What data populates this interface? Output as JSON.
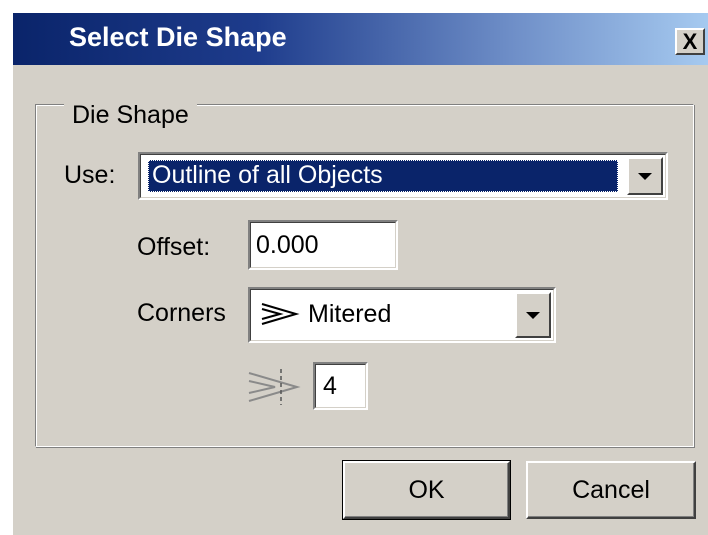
{
  "dialog": {
    "title": "Select Die Shape",
    "close_glyph": "X"
  },
  "group": {
    "legend": "Die Shape"
  },
  "use": {
    "label": "Use:",
    "selected": "Outline of all Objects"
  },
  "offset": {
    "label": "Offset:",
    "value": "0.000"
  },
  "corners": {
    "label": "Corners",
    "selected": "Mitered",
    "icon": "mitered-corner-icon"
  },
  "miter_limit": {
    "icon": "miter-limit-icon",
    "value": "4"
  },
  "buttons": {
    "ok": "OK",
    "cancel": "Cancel"
  }
}
